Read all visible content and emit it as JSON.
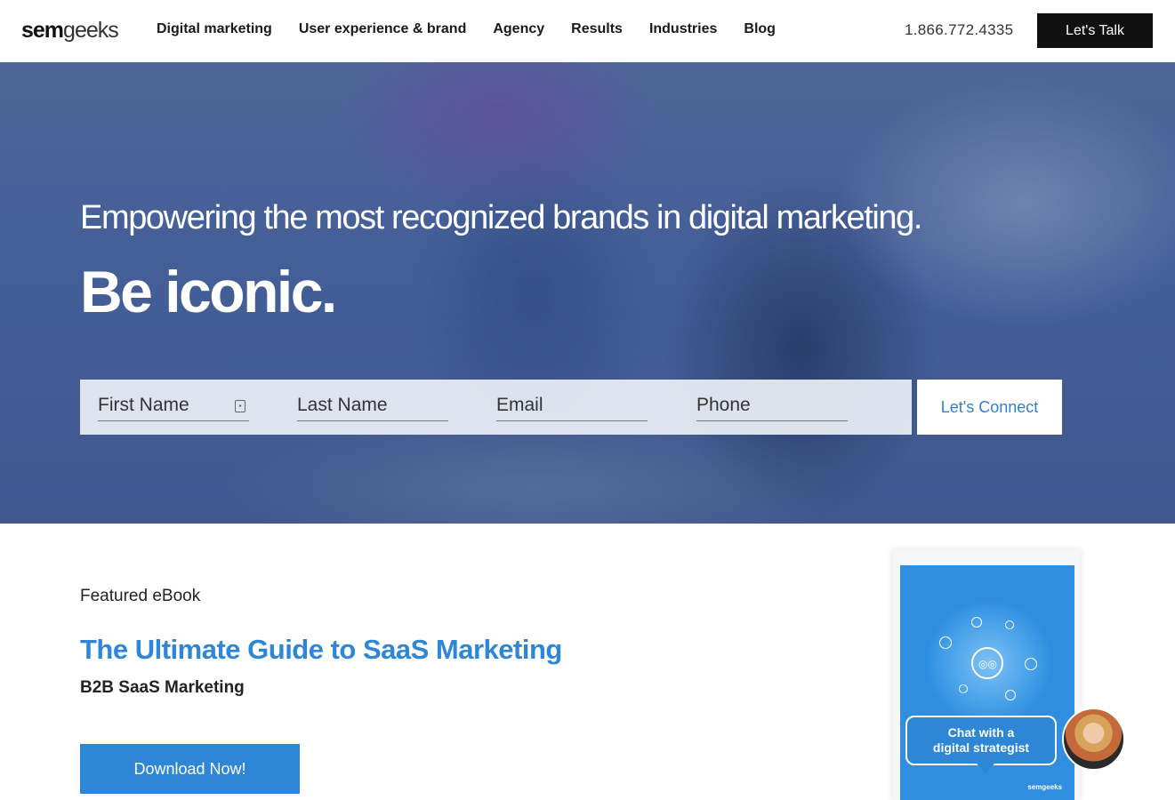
{
  "header": {
    "logo_bold": "sem",
    "logo_light": "geeks",
    "nav": [
      {
        "label": "Digital marketing"
      },
      {
        "label": "User experience & brand"
      },
      {
        "label": "Agency"
      },
      {
        "label": "Results"
      },
      {
        "label": "Industries"
      },
      {
        "label": "Blog"
      }
    ],
    "phone": "1.866.772.4335",
    "cta_label": "Let's Talk"
  },
  "hero": {
    "subtitle": "Empowering the most recognized brands in digital marketing.",
    "title": "Be iconic.",
    "form": {
      "first_name_placeholder": "First Name",
      "last_name_placeholder": "Last Name",
      "email_placeholder": "Email",
      "phone_placeholder": "Phone",
      "submit_label": "Let's Connect"
    }
  },
  "featured": {
    "label": "Featured eBook",
    "title": "The Ultimate Guide to SaaS Marketing",
    "subtitle": "B2B SaaS Marketing",
    "button_label": "Download Now!",
    "ebook_brand": "semgeeks"
  },
  "chat": {
    "line1": "Chat with a",
    "line2": "digital strategist"
  },
  "colors": {
    "accent": "#2e86d6",
    "dark": "#111111",
    "hero_overlay": "#4c639a"
  }
}
